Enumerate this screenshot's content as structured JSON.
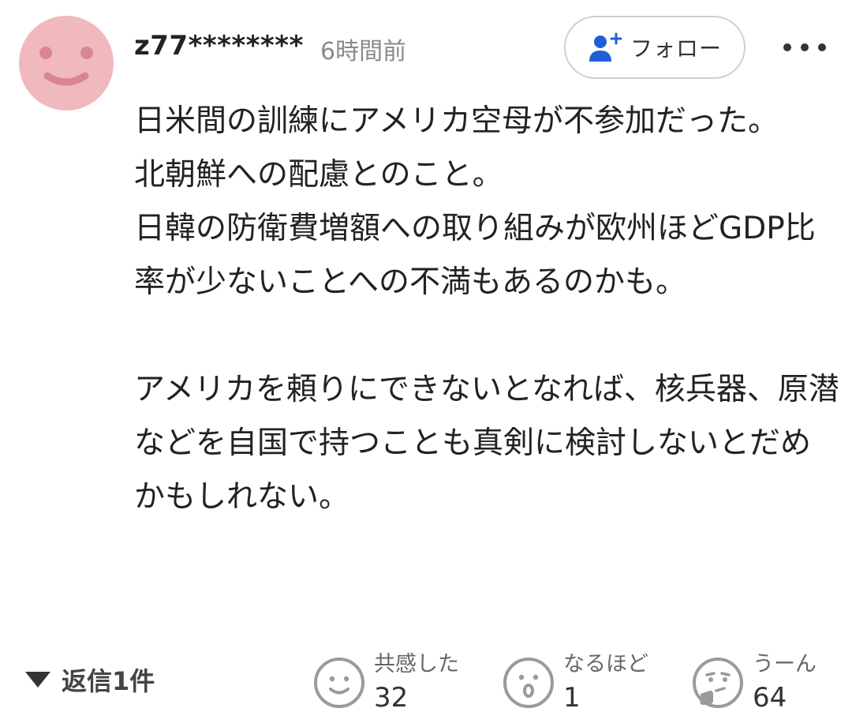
{
  "comment": {
    "username": "z77********",
    "timestamp": "6時間前",
    "body": "日米間の訓練にアメリカ空母が不参加だった。\n北朝鮮への配慮とのこと。\n日韓の防衛費増額への取り組みが欧州ほどGDP比率が少ないことへの不満もあるのかも。\n\nアメリカを頼りにできないとなれば、核兵器、原潜などを自国で持つことも真剣に検討しないとだめかもしれない。"
  },
  "follow": {
    "label": "フォロー",
    "icon": "add-user-icon"
  },
  "more": {
    "icon": "more-dots-icon"
  },
  "replies": {
    "label": "返信1件",
    "icon": "triangle-down-icon"
  },
  "reactions": [
    {
      "label": "共感した",
      "count": "32",
      "icon": "smile-face-icon"
    },
    {
      "label": "なるほど",
      "count": "1",
      "icon": "surprised-face-icon"
    },
    {
      "label": "うーん",
      "count": "64",
      "icon": "thinking-face-icon"
    }
  ],
  "colors": {
    "avatar": "#efb9bd",
    "avatar_features": "#d9868e",
    "accent_blue": "#1f5fd6",
    "muted_text": "#8a8a8a",
    "reaction_icon": "#9a9a9a"
  }
}
